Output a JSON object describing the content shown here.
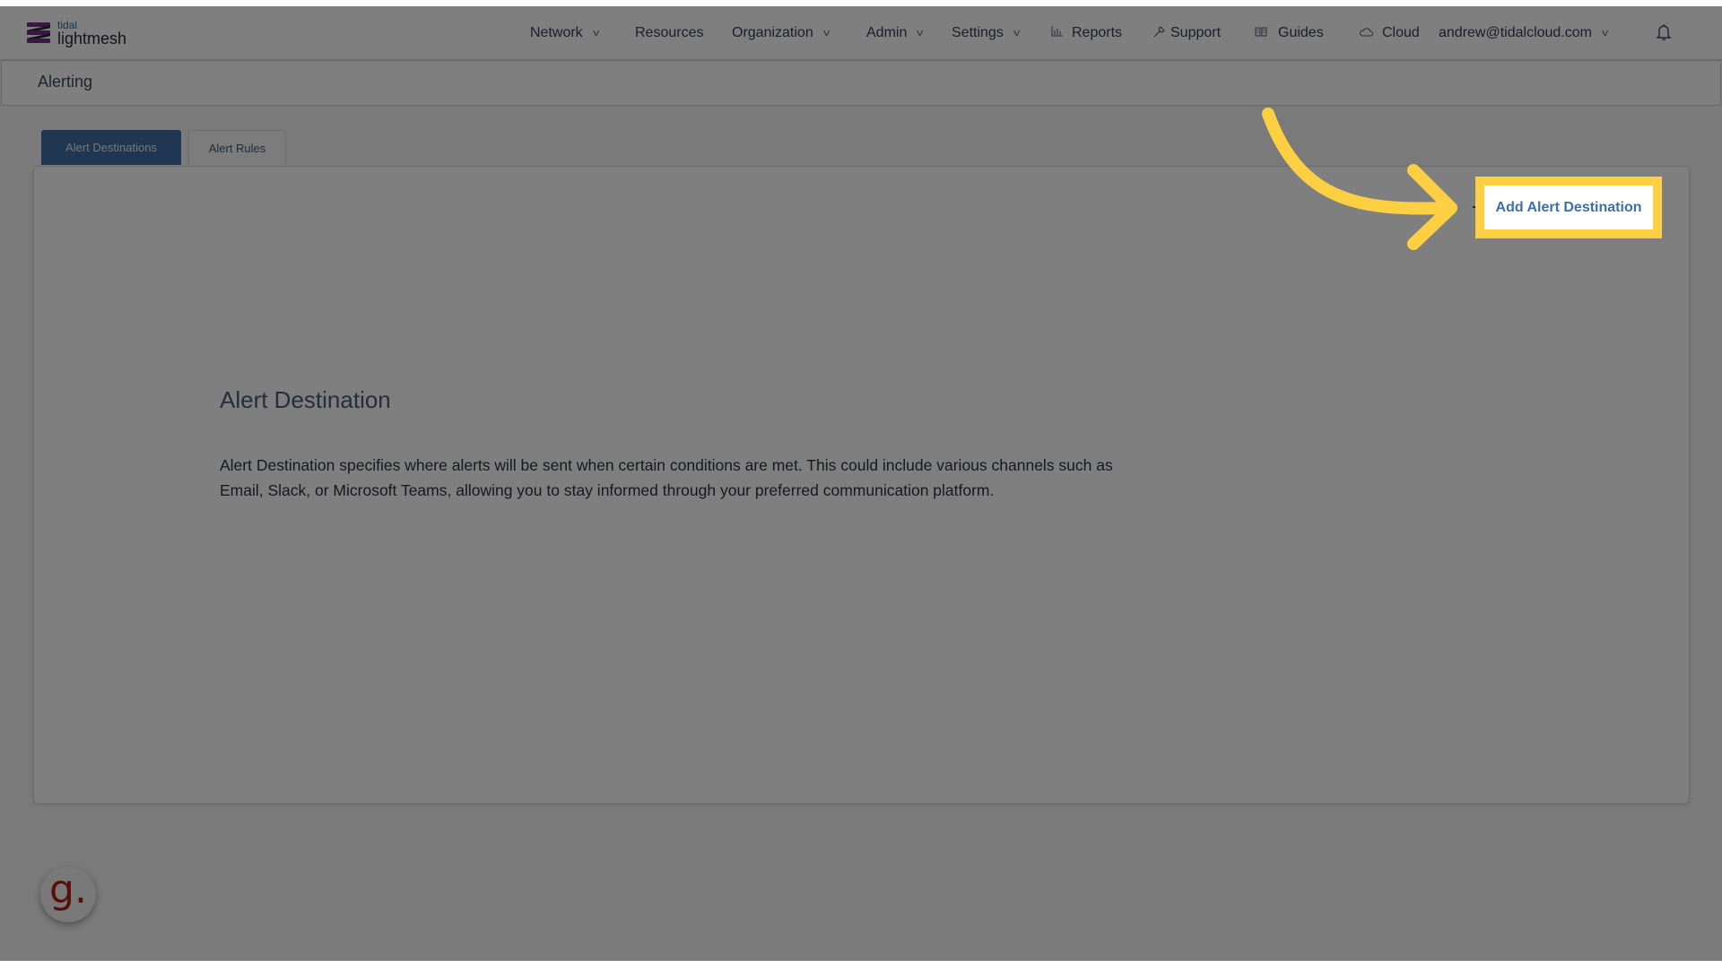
{
  "header": {
    "logo": {
      "small": "tidal",
      "big": "lightmesh"
    },
    "nav": [
      {
        "label": "Network",
        "dropdown": true
      },
      {
        "label": "Resources",
        "dropdown": false
      },
      {
        "label": "Organization",
        "dropdown": true
      },
      {
        "label": "Admin",
        "dropdown": true
      },
      {
        "label": "Settings",
        "dropdown": true
      },
      {
        "label": "Reports",
        "icon": "bar-chart-icon"
      },
      {
        "label": "Support",
        "icon": "wrench-icon"
      },
      {
        "label": "Guides",
        "icon": "book-icon"
      },
      {
        "label": "Cloud",
        "icon": "cloud-icon"
      },
      {
        "label": "andrew@tidalcloud.com",
        "dropdown": true
      }
    ],
    "bell_icon": "bell-icon"
  },
  "breadcrumb": {
    "title": "Alerting"
  },
  "tabs": [
    {
      "label": "Alert Destinations",
      "active": true
    },
    {
      "label": "Alert Rules",
      "active": false
    }
  ],
  "card": {
    "add_button_label": "Add Alert Destination",
    "empty_state": {
      "title": "Alert Destination",
      "description": "Alert Destination specifies where alerts will be sent when certain conditions are met. This could include various channels such as Email, Slack, or Microsoft Teams, allowing you to stay informed through your preferred communication platform."
    }
  },
  "guide_badge": {
    "letter": "g."
  },
  "colors": {
    "primary": "#3e6fa6",
    "highlight": "#fdd043",
    "badge_red": "#b51d13",
    "overlay": "rgba(0,0,0,0.5)"
  }
}
